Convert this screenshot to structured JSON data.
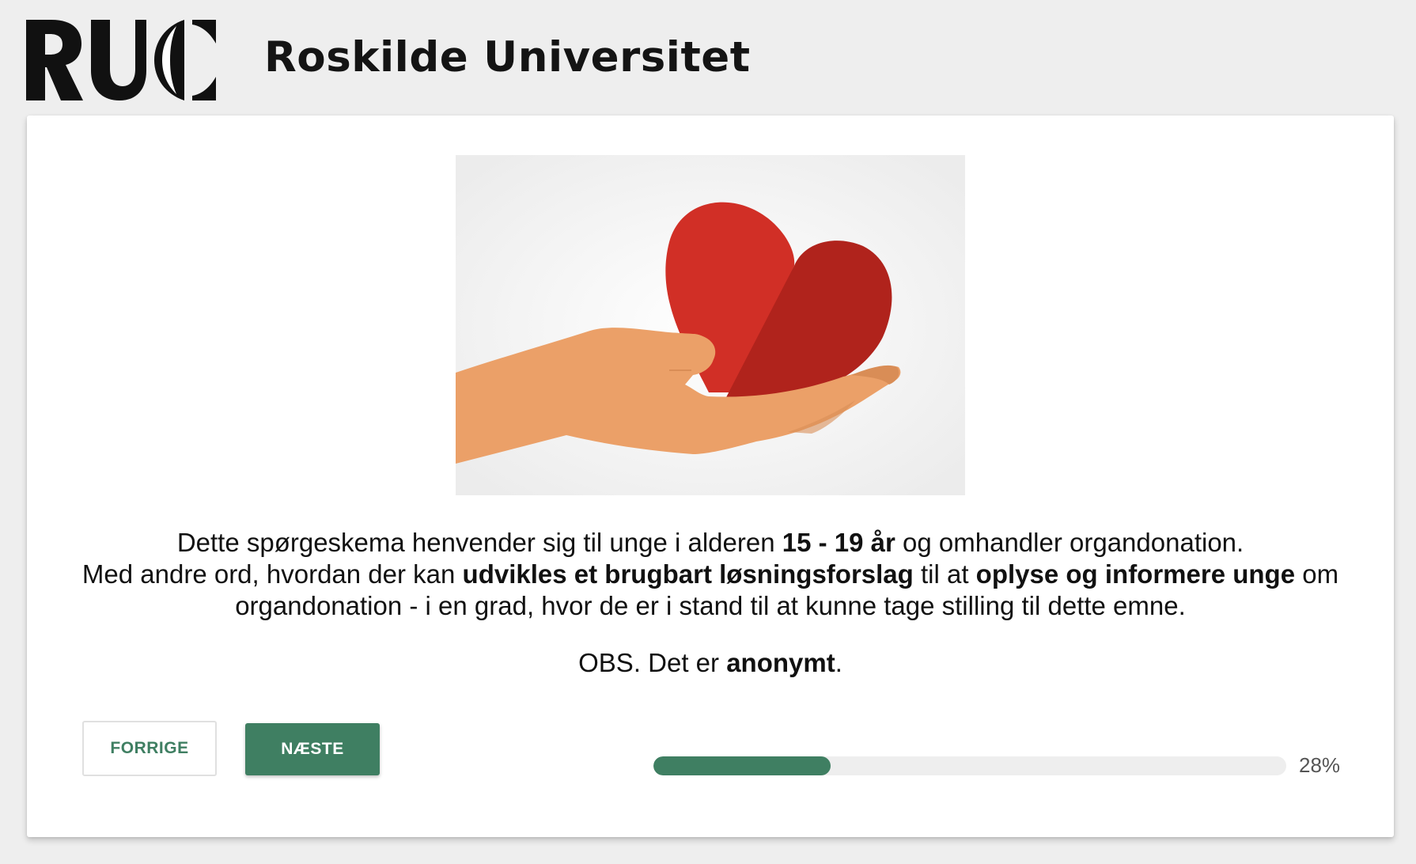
{
  "header": {
    "logo_text": "RUC",
    "university_name": "Roskilde Universitet"
  },
  "main": {
    "image_description": "hand-holding-heart",
    "intro": {
      "line1_a": "Dette spørgeskema henvender sig til unge i alderen ",
      "line1_bold": "15 - 19 år",
      "line1_b": " og omhandler organdonation.",
      "line2_a": "Med andre ord, hvordan der kan ",
      "line2_bold1": "udvikles et brugbart løsningsforslag",
      "line2_b": " til at ",
      "line2_bold2": "oplyse og informere unge",
      "line2_c": " om",
      "line3": "organdonation - i en grad, hvor de er i stand til at kunne tage stilling til dette emne."
    },
    "notice": {
      "text_a": "OBS. Det er ",
      "text_bold": "anonymt",
      "text_b": "."
    }
  },
  "navigation": {
    "prev_label": "FORRIGE",
    "next_label": "NÆSTE"
  },
  "progress": {
    "value": 0.28,
    "label": "28%"
  },
  "colors": {
    "accent": "#3f7f62",
    "background": "#eeeeee",
    "card": "#ffffff"
  }
}
